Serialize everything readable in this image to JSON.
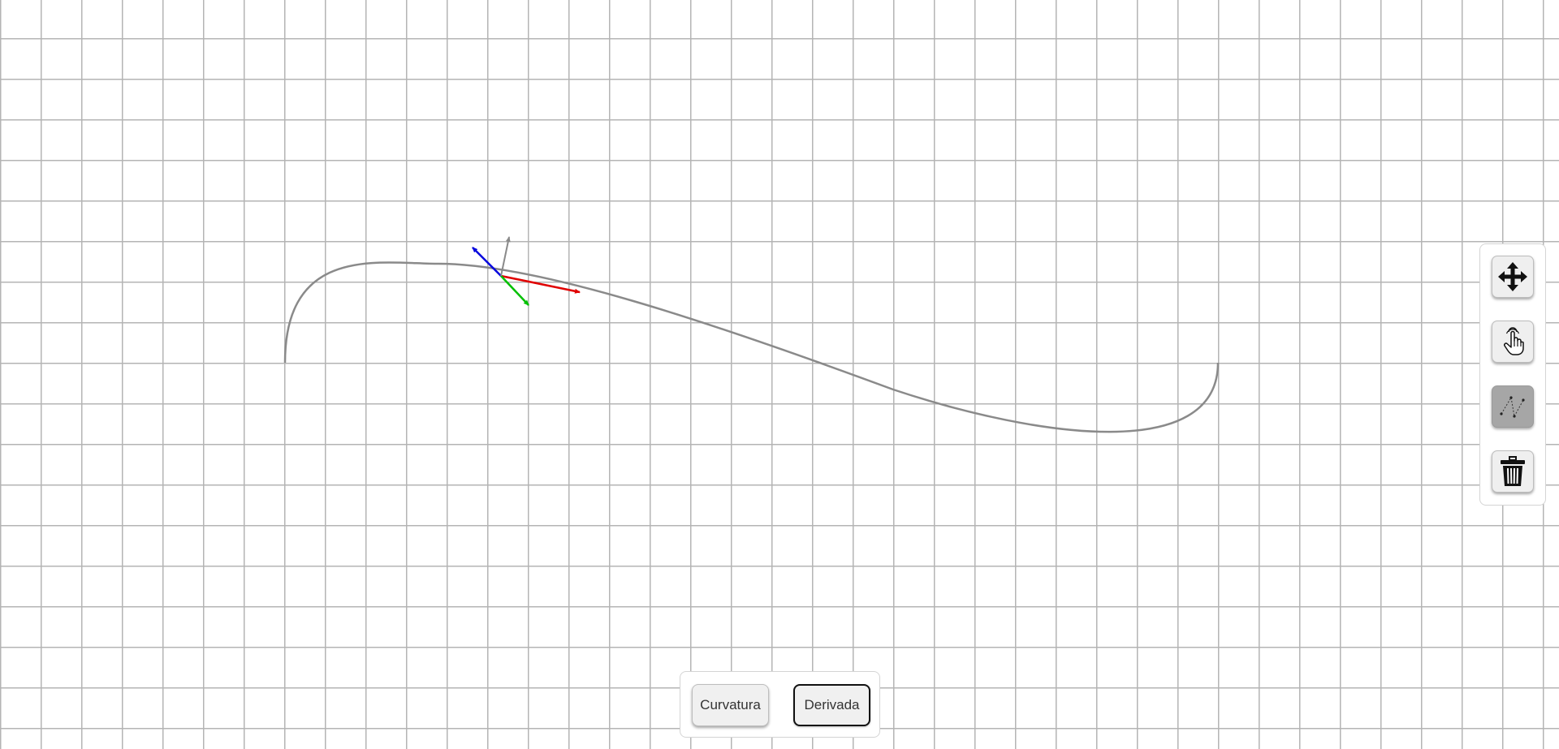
{
  "toolbar": {
    "tools": [
      {
        "icon": "move-arrows-icon",
        "active": false
      },
      {
        "icon": "pointer-hand-icon",
        "active": false
      },
      {
        "icon": "control-polygon-icon",
        "active": true
      },
      {
        "icon": "trash-icon",
        "active": false
      }
    ]
  },
  "bottom_bar": {
    "curvature_label": "Curvatura",
    "derivative_label": "Derivada",
    "selected": "Derivada"
  },
  "colors": {
    "grid": "#b4b4b4",
    "curve": "#8a8a8a",
    "tangent_vector": "#e00000",
    "normal_vector": "#00c000",
    "binormal_vector": "#0000dd",
    "up_vector": "#8a8a8a",
    "active_tool": "#a6a6a6"
  }
}
